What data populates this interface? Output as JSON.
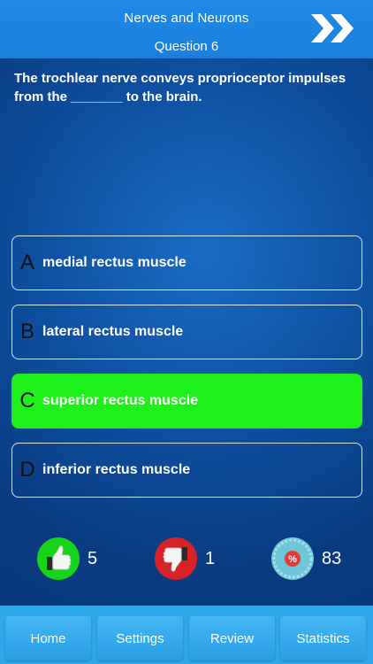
{
  "header": {
    "title": "Nerves and Neurons",
    "question_number": "Question 6",
    "next_icon": "double-chevron-right-icon"
  },
  "question": {
    "text": "The trochlear nerve conveys proprioceptor impulses from the _______ to the brain."
  },
  "answers": [
    {
      "letter": "A",
      "text": "medial rectus muscle",
      "state": "default"
    },
    {
      "letter": "B",
      "text": "lateral rectus muscle",
      "state": "default"
    },
    {
      "letter": "C",
      "text": "superior rectus muscle",
      "state": "correct"
    },
    {
      "letter": "D",
      "text": "inferior rectus muscle",
      "state": "default"
    }
  ],
  "stats": {
    "correct": {
      "icon": "thumbs-up-icon",
      "value": "5",
      "color": "#17d41b"
    },
    "wrong": {
      "icon": "thumbs-down-icon",
      "value": "1",
      "color": "#d8222a"
    },
    "percent": {
      "icon": "percent-badge-icon",
      "value": "83",
      "color": "#6fc6d8"
    }
  },
  "tabs": [
    {
      "label": "Home"
    },
    {
      "label": "Settings"
    },
    {
      "label": "Review"
    },
    {
      "label": "Statistics"
    }
  ],
  "colors": {
    "header": "#1e8ae6",
    "correct_answer": "#1ef01a",
    "footer": "#2fa8ec"
  }
}
